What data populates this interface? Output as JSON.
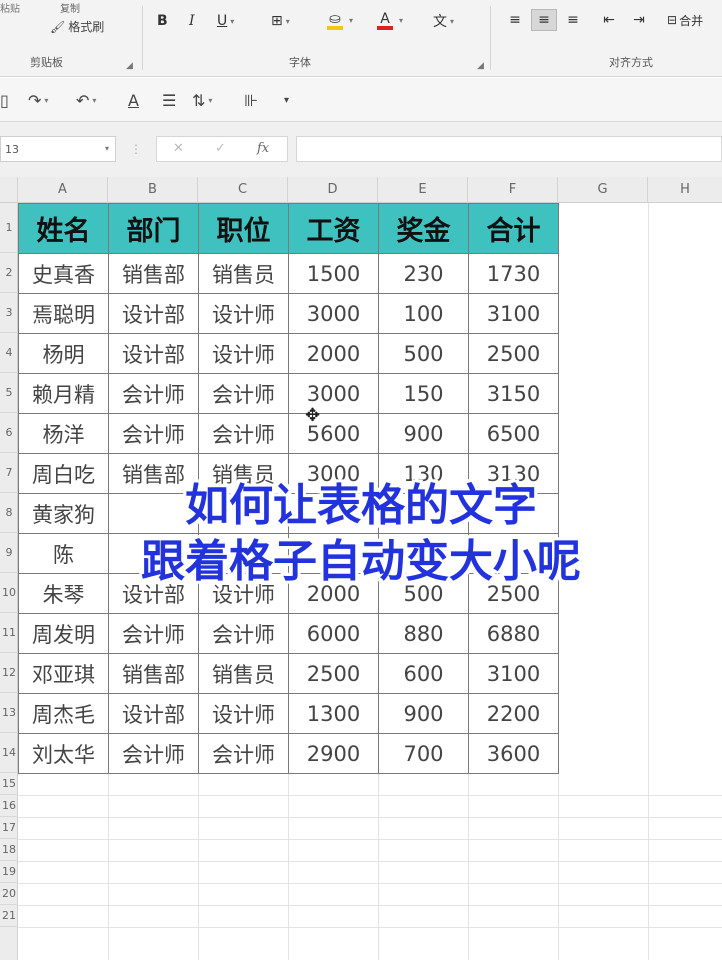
{
  "ribbon": {
    "clipboard": {
      "paste_partial": "粘贴",
      "copy_label": "复制",
      "format_painter": "格式刷",
      "group_label": "剪贴板"
    },
    "font": {
      "bold": "B",
      "italic": "I",
      "underline": "U",
      "font_color_letter": "A",
      "group_label": "字体",
      "fill_color": "#f2c811",
      "font_color": "#e02020"
    },
    "alignment": {
      "group_label": "对齐方式",
      "merge_label": "合并"
    }
  },
  "formula_bar": {
    "name_box": "13",
    "fx": "fx",
    "cancel": "✕",
    "confirm": "✓"
  },
  "sheet": {
    "columns": [
      "A",
      "B",
      "C",
      "D",
      "E",
      "F",
      "G",
      "H"
    ],
    "rows": [
      "1",
      "2",
      "3",
      "4",
      "5",
      "6",
      "7",
      "8",
      "9",
      "10",
      "11",
      "12",
      "13",
      "14",
      "15",
      "16",
      "17",
      "18",
      "19",
      "20",
      "21"
    ],
    "table": {
      "header": [
        "姓名",
        "部门",
        "职位",
        "工资",
        "奖金",
        "合计"
      ],
      "header_color": "#3fc1c0",
      "rows": [
        [
          "史真香",
          "销售部",
          "销售员",
          "1500",
          "230",
          "1730"
        ],
        [
          "焉聪明",
          "设计部",
          "设计师",
          "3000",
          "100",
          "3100"
        ],
        [
          "杨明",
          "设计部",
          "设计师",
          "2000",
          "500",
          "2500"
        ],
        [
          "赖月精",
          "会计师",
          "会计师",
          "3000",
          "150",
          "3150"
        ],
        [
          "杨洋",
          "会计师",
          "会计师",
          "5600",
          "900",
          "6500"
        ],
        [
          "周白吃",
          "销售部",
          "销售员",
          "3000",
          "130",
          "3130"
        ],
        [
          "黄家狗",
          "",
          "",
          "",
          "",
          ""
        ],
        [
          "陈",
          "",
          "",
          "",
          "",
          ""
        ],
        [
          "朱琴",
          "设计部",
          "设计师",
          "2000",
          "500",
          "2500"
        ],
        [
          "周发明",
          "会计师",
          "会计师",
          "6000",
          "880",
          "6880"
        ],
        [
          "邓亚琪",
          "销售部",
          "销售员",
          "2500",
          "600",
          "3100"
        ],
        [
          "周杰毛",
          "设计部",
          "设计师",
          "1300",
          "900",
          "2200"
        ],
        [
          "刘太华",
          "会计师",
          "会计师",
          "2900",
          "700",
          "3600"
        ]
      ]
    }
  },
  "caption": {
    "line1": "如何让表格的文字",
    "line2": "跟着格子自动变大小呢",
    "color": "#2233dd"
  }
}
